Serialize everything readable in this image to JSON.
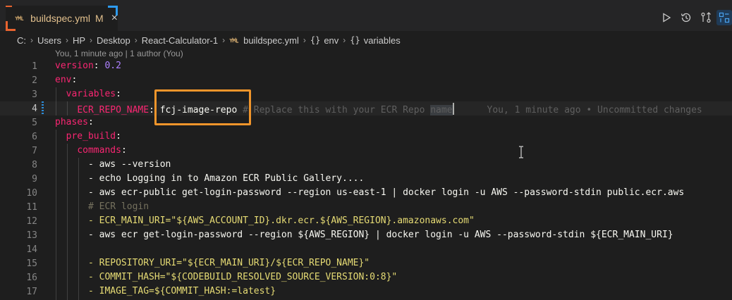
{
  "tab": {
    "filename": "buildspec.yml",
    "status": "M",
    "close": "×"
  },
  "toolbar": {
    "run_icon": "run-icon",
    "timeline_icon": "timeline-icon",
    "compare_icon": "compare-changes-icon",
    "split_icon": "split-editor-icon"
  },
  "breadcrumb": {
    "items": [
      "C:",
      "Users",
      "HP",
      "Desktop",
      "React-Calculator-1",
      "buildspec.yml",
      "env",
      "variables"
    ],
    "brace": "{}"
  },
  "codelens": "You, 1 minute ago | 1 author (You)",
  "editor": {
    "lines": {
      "n1": "1",
      "n2": "2",
      "n3": "3",
      "n4": "4",
      "n5": "5",
      "n6": "6",
      "n7": "7",
      "n8": "8",
      "n9": "9",
      "n10": "10",
      "n11": "11",
      "n12": "12",
      "n13": "13",
      "n14": "14",
      "n15": "15",
      "n16": "16",
      "n17": "17"
    },
    "version_key": "version",
    "version_value": "0.2",
    "env_key": "env",
    "variables_key": "variables",
    "ecr_repo_key": "ECR_REPO_NAME",
    "ecr_repo_value": "fcj-image-repo",
    "ecr_repo_comment_prefix": "# Replace this with your ECR Repo ",
    "ecr_repo_comment_word": "name",
    "ecr_repo_blame": "You, 1 minute ago • Uncommitted changes",
    "phases_key": "phases",
    "pre_build_key": "pre_build",
    "commands_key": "commands",
    "cmd8": "- aws --version",
    "cmd9": "- echo Logging in to Amazon ECR Public Gallery....",
    "cmd10": "- aws ecr-public get-login-password --region us-east-1 | docker login -u AWS --password-stdin public.ecr.aws",
    "cmd11": "# ECR login",
    "cmd12": "- ECR_MAIN_URI=\"${AWS_ACCOUNT_ID}.dkr.ecr.${AWS_REGION}.amazonaws.com\"",
    "cmd13": "- aws ecr get-login-password --region ${AWS_REGION} | docker login -u AWS --password-stdin ${ECR_MAIN_URI}",
    "cmd15": "- REPOSITORY_URI=\"${ECR_MAIN_URI}/${ECR_REPO_NAME}\"",
    "cmd16": "- COMMIT_HASH=\"${CODEBUILD_RESOLVED_SOURCE_VERSION:0:8}\"",
    "cmd17": "- IMAGE_TAG=${COMMIT_HASH:=latest}",
    "colon": ":"
  },
  "colors": {
    "key": "#f92672",
    "string": "#e6db74",
    "number": "#ae81ff",
    "comment": "#75715e",
    "highlight": "#f0952b",
    "modified": "#e2c08d"
  }
}
